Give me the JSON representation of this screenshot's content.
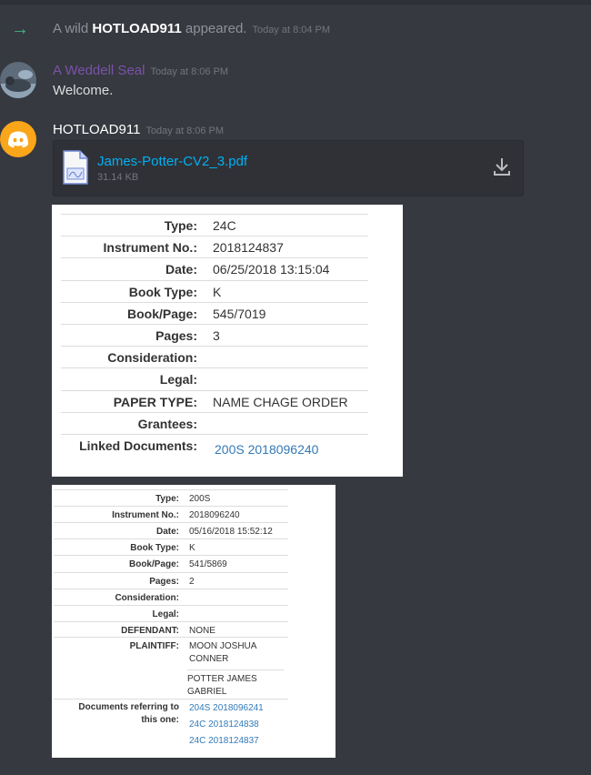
{
  "system_message": {
    "prefix": "A wild",
    "username": "HOTLOAD911",
    "suffix": "appeared.",
    "timestamp": "Today at 8:04 PM"
  },
  "message1": {
    "author": "A Weddell Seal",
    "author_color": "#7b52ab",
    "timestamp": "Today at 8:06 PM",
    "text": "Welcome."
  },
  "message2": {
    "author": "HOTLOAD911",
    "timestamp": "Today at 8:06 PM",
    "attachment": {
      "filename": "James-Potter-CV2_3.pdf",
      "size": "31.14 KB"
    }
  },
  "record1": {
    "rows": [
      {
        "label": "Type:",
        "value": "24C"
      },
      {
        "label": "Instrument No.:",
        "value": "2018124837"
      },
      {
        "label": "Date:",
        "value": "06/25/2018 13:15:04"
      },
      {
        "label": "Book Type:",
        "value": "K"
      },
      {
        "label": "Book/Page:",
        "value": "545/7019"
      },
      {
        "label": "Pages:",
        "value": "3"
      },
      {
        "label": "Consideration:",
        "value": ""
      },
      {
        "label": "Legal:",
        "value": ""
      },
      {
        "label": "PAPER TYPE:",
        "value": "NAME CHAGE ORDER"
      },
      {
        "label": "Grantees:",
        "value": ""
      },
      {
        "label": "Linked Documents:",
        "value": "200S 2018096240"
      }
    ]
  },
  "record2": {
    "rows": [
      {
        "label": "Type:",
        "value": "200S"
      },
      {
        "label": "Instrument No.:",
        "value": "2018096240"
      },
      {
        "label": "Date:",
        "value": "05/16/2018 15:52:12"
      },
      {
        "label": "Book Type:",
        "value": "K"
      },
      {
        "label": "Book/Page:",
        "value": "541/5869"
      },
      {
        "label": "Pages:",
        "value": "2"
      },
      {
        "label": "Consideration:",
        "value": ""
      },
      {
        "label": "Legal:",
        "value": ""
      },
      {
        "label": "DEFENDANT:",
        "value": "NONE"
      }
    ],
    "plaintiff_label": "PLAINTIFF:",
    "plaintiff_1a": "MOON JOSHUA",
    "plaintiff_1b": "CONNER",
    "plaintiff_2a": "POTTER JAMES",
    "plaintiff_2b": "GABRIEL",
    "refs_label_1": "Documents referring to",
    "refs_label_2": "this one:",
    "refs": [
      "204S 2018096241",
      "24C 2018124838",
      "24C 2018124837"
    ]
  },
  "colors": {
    "background": "#36393f",
    "link": "#00b0f4",
    "system_arrow": "#43b581",
    "discord_blurple": "#faa61a"
  }
}
